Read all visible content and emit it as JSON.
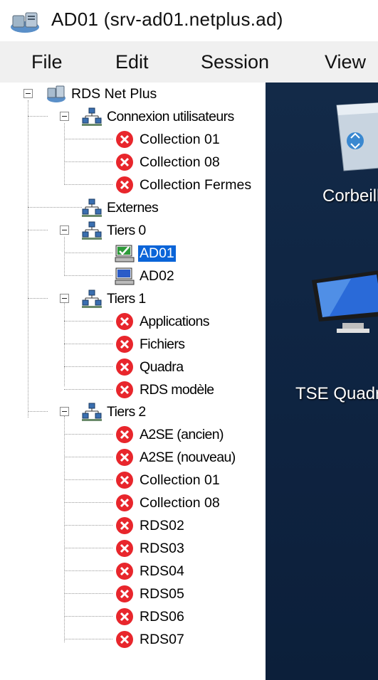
{
  "window": {
    "title": "AD01 (srv-ad01.netplus.ad)"
  },
  "menu": {
    "file": "File",
    "edit": "Edit",
    "session": "Session",
    "view": "View"
  },
  "tree": {
    "root": "RDS Net Plus",
    "groups": [
      {
        "label": "Connexion utilisateurs",
        "items": [
          "Collection 01",
          "Collection 08",
          "Collection Fermes"
        ]
      },
      {
        "label": "Externes",
        "items": []
      },
      {
        "label": "Tiers 0",
        "items": [
          "AD01",
          "AD02"
        ],
        "selected": "AD01"
      },
      {
        "label": "Tiers 1",
        "items": [
          "Applications",
          "Fichiers",
          "Quadra",
          "RDS modèle"
        ]
      },
      {
        "label": "Tiers 2",
        "items": [
          "A2SE (ancien)",
          "A2SE (nouveau)",
          "Collection 01",
          "Collection 08",
          "RDS02",
          "RDS03",
          "RDS04",
          "RDS05",
          "RDS06",
          "RDS07"
        ]
      }
    ]
  },
  "desktop": {
    "icons": [
      {
        "label": "Corbeille",
        "icon": "recycle-bin-icon"
      },
      {
        "label": "TSE Quadra",
        "icon": "monitor-icon"
      }
    ]
  },
  "colors": {
    "selection": "#0a64d8",
    "error": "#e8262c",
    "desktop_bg": "#0f2543"
  }
}
